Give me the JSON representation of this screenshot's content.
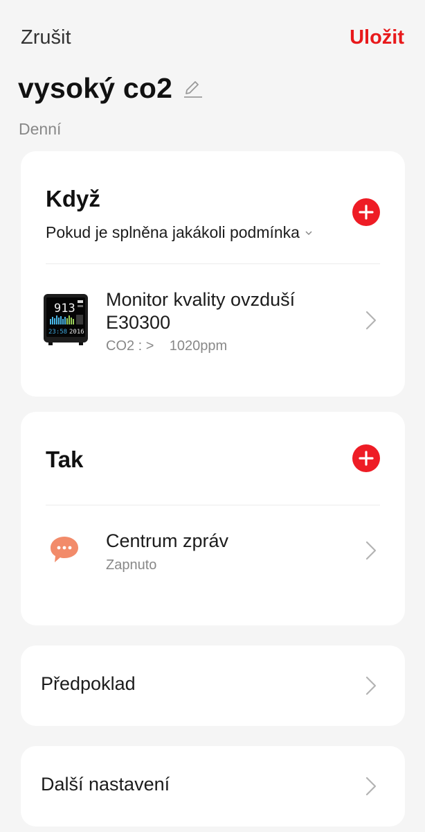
{
  "header": {
    "cancel_label": "Zrušit",
    "save_label": "Uložit",
    "title": "vysoký co2",
    "subtitle": "Denní"
  },
  "when": {
    "title": "Když",
    "condition_mode": "Pokud je splněna jakákoli podmínka",
    "device": {
      "name_line1": "Monitor kvality ovzduší",
      "name_line2": "E30300",
      "condition": "CO2 : >    1020ppm",
      "screen_reading": "913",
      "screen_time": "23:58",
      "screen_year": "2016"
    }
  },
  "then": {
    "title": "Tak",
    "action": {
      "name": "Centrum zpráv",
      "status": "Zapnuto"
    }
  },
  "precondition_label": "Předpoklad",
  "more_settings_label": "Další nastavení",
  "colors": {
    "accent": "#ee1c25",
    "save_text": "#e8191b",
    "message_icon": "#f28b6a",
    "background": "#f5f5f5"
  },
  "icons": {
    "edit": "pencil-icon",
    "add": "plus-circle-icon",
    "chevron": "chevron-right-icon",
    "dropdown": "chevron-down-icon",
    "message": "chat-bubble-icon"
  }
}
